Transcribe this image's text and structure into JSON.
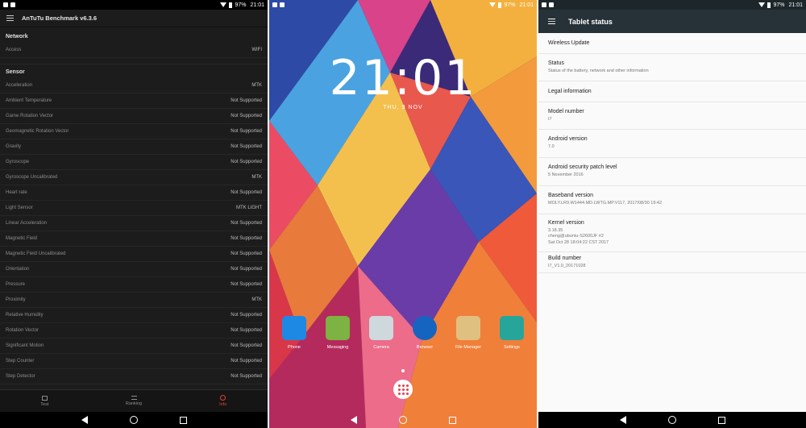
{
  "status": {
    "battery": "97%",
    "time": "21:01"
  },
  "antutu": {
    "title": "AnTuTu Benchmark v6.3.6",
    "network_section": "Network",
    "network_rows": [
      {
        "label": "Access",
        "value": "WIFI"
      }
    ],
    "sensor_section": "Sensor",
    "sensor_rows": [
      {
        "label": "Acceleration",
        "value": "MTK"
      },
      {
        "label": "Ambient Temperature",
        "value": "Not Supported"
      },
      {
        "label": "Game Rotation Vector",
        "value": "Not Supported"
      },
      {
        "label": "Geomagnetic Rotation Vector",
        "value": "Not Supported"
      },
      {
        "label": "Gravity",
        "value": "Not Supported"
      },
      {
        "label": "Gyroscope",
        "value": "Not Supported"
      },
      {
        "label": "Gyroscope Uncalibrated",
        "value": "MTK"
      },
      {
        "label": "Heart rate",
        "value": "Not Supported"
      },
      {
        "label": "Light Sensor",
        "value": "MTK LIGHT"
      },
      {
        "label": "Linear Acceleration",
        "value": "Not Supported"
      },
      {
        "label": "Magnetic Field",
        "value": "Not Supported"
      },
      {
        "label": "Magnetic Field Uncalibrated",
        "value": "Not Supported"
      },
      {
        "label": "Orientation",
        "value": "Not Supported"
      },
      {
        "label": "Pressure",
        "value": "Not Supported"
      },
      {
        "label": "Proximity",
        "value": "MTK"
      },
      {
        "label": "Relative Humidity",
        "value": "Not Supported"
      },
      {
        "label": "Rotation Vector",
        "value": "Not Supported"
      },
      {
        "label": "Significant Motion",
        "value": "Not Supported"
      },
      {
        "label": "Step Counter",
        "value": "Not Supported"
      },
      {
        "label": "Step Detector",
        "value": "Not Supported"
      }
    ],
    "tabs": [
      {
        "label": "Test",
        "icon": "home-icon"
      },
      {
        "label": "Ranking",
        "icon": "list-icon"
      },
      {
        "label": "Info",
        "icon": "info-icon"
      }
    ],
    "accent": "#e04433"
  },
  "lockscreen": {
    "clock": "21:01",
    "date": "THU, 9 NOV",
    "apps": [
      {
        "label": "Phone",
        "color": "#1e88e5"
      },
      {
        "label": "Messaging",
        "color": "#7cb342"
      },
      {
        "label": "Camera",
        "color": "#cfd8dc"
      },
      {
        "label": "Browser",
        "color": "#1565c0"
      },
      {
        "label": "File Manager",
        "color": "#e0c080"
      },
      {
        "label": "Settings",
        "color": "#26a69a"
      }
    ]
  },
  "settings": {
    "title": "Tablet status",
    "items": [
      {
        "title": "Wireless Update",
        "sub": ""
      },
      {
        "title": "Status",
        "sub": "Status of the battery, network and other information"
      },
      {
        "title": "Legal information",
        "sub": ""
      },
      {
        "title": "Model number",
        "sub": "I7"
      },
      {
        "title": "Android version",
        "sub": "7.0"
      },
      {
        "title": "Android security patch level",
        "sub": "5 November 2016"
      },
      {
        "title": "Baseband version",
        "sub": "MOLY.LR9.W1444.MD.LWTG.MP.V117, 2017/08/30 19:42"
      },
      {
        "title": "Kernel version",
        "sub": "3.18.35\ncheng@ubuntu-S2600JF #2\nSat Oct 28 18:04:22 CST 2017"
      },
      {
        "title": "Build number",
        "sub": "I7_V1.0_20171028"
      }
    ]
  }
}
